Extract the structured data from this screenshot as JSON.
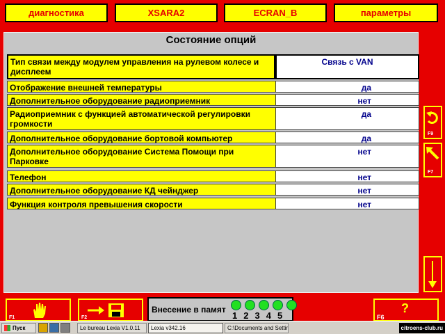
{
  "top_tabs": [
    "диагностика",
    "XSARA2",
    "ECRAN_B",
    "параметры"
  ],
  "panel": {
    "title": "Состояние опций",
    "rows": [
      {
        "label": "Тип связи между модулем управления на рулевом колесе и дисплеем",
        "value": "Связь с VAN"
      },
      {
        "label": "Отображение внешней температуры",
        "value": "да"
      },
      {
        "label": "Дополнительное оборудование радиоприемник",
        "value": "нет"
      },
      {
        "label": "Радиоприемник с функцией автоматической регулировки громкости",
        "value": "да"
      },
      {
        "label": "Дополнительное оборудование бортовой компьютер",
        "value": "да"
      },
      {
        "label": "Дополнительное оборудование Система Помощи при Парковке",
        "value": "нет"
      },
      {
        "label": "Телефон",
        "value": "нет"
      },
      {
        "label": "Дополнительное оборудование КД чейнджер",
        "value": "нет"
      },
      {
        "label": "Функция контроля превышения скорости",
        "value": "нет"
      }
    ]
  },
  "side_buttons": {
    "f9": "F9",
    "f7": "F7"
  },
  "bottom": {
    "f1": "F1",
    "f2": "F2",
    "f6": "F6",
    "help": "?",
    "memory_label": "Внесение в памят",
    "memory_slots": [
      "1",
      "2",
      "3",
      "4",
      "5"
    ]
  },
  "taskbar": {
    "start": "Пуск",
    "tasks": [
      "Le bureau Lexia V1.0.11",
      "Lexia v342.16",
      "C:\\Documents and Settin..."
    ],
    "tray_text": "citroens-club.ru"
  },
  "colors": {
    "background": "#e60000",
    "yellow": "#ffff00",
    "value_text": "#00008b",
    "panel": "#c6c6c6"
  }
}
